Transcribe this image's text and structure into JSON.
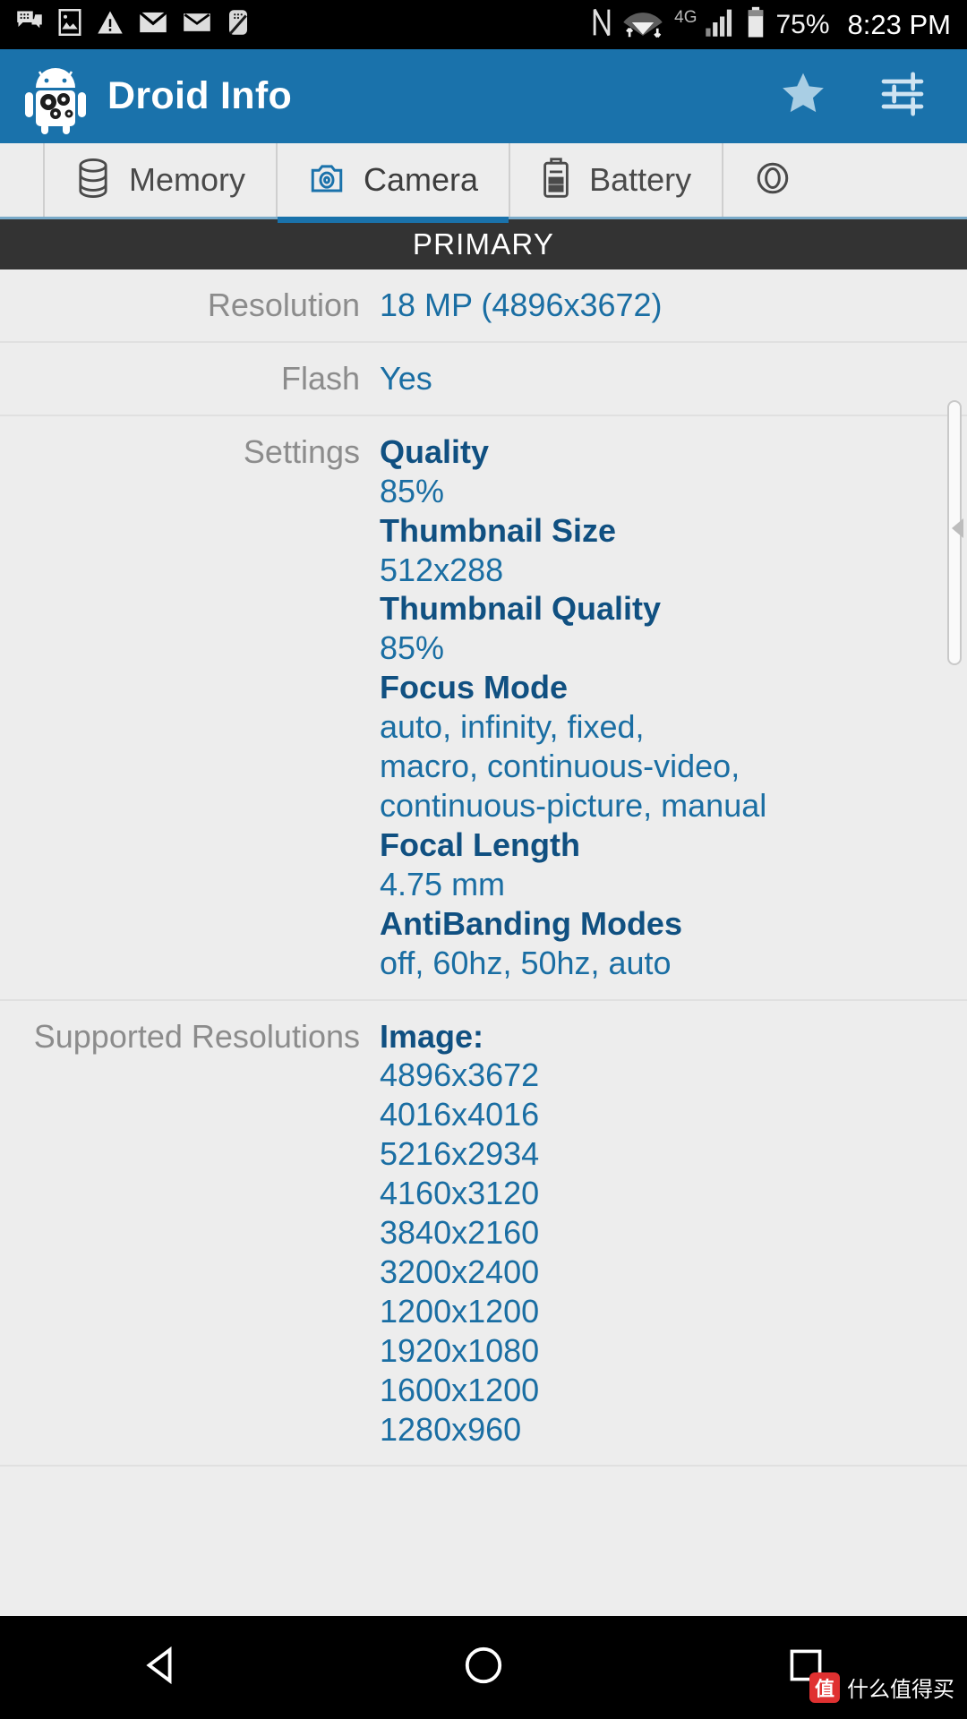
{
  "statusbar": {
    "icons_left": [
      "chat-bubble-icon",
      "image-icon",
      "warning-triangle-icon",
      "mail-filled-icon",
      "mail-outline-icon",
      "note-slash-icon"
    ],
    "icons_right": [
      "nfc-icon",
      "wifi-icon",
      "signal-bars-icon",
      "battery-icon"
    ],
    "network_type": "4G",
    "battery_percent": "75%",
    "time": "8:23 PM"
  },
  "appbar": {
    "logo_icon": "android-droid-gears-icon",
    "title": "Droid Info",
    "star_icon": "star-icon",
    "settings_icon": "sliders-icon"
  },
  "tabs": [
    {
      "label": "Memory",
      "icon": "database-icon",
      "active": false
    },
    {
      "label": "Camera",
      "icon": "camera-icon",
      "active": true
    },
    {
      "label": "Battery",
      "icon": "battery-vertical-icon",
      "active": false
    },
    {
      "label": "",
      "icon": "eye-icon",
      "active": false
    }
  ],
  "section_header": "PRIMARY",
  "rows": [
    {
      "label": "Resolution",
      "lines": [
        {
          "text": "18 MP (4896x3672)",
          "bold": false
        }
      ]
    },
    {
      "label": "Flash",
      "lines": [
        {
          "text": "Yes",
          "bold": false
        }
      ]
    },
    {
      "label": "Settings",
      "lines": [
        {
          "text": "Quality",
          "bold": true
        },
        {
          "text": "85%",
          "bold": false
        },
        {
          "text": "Thumbnail Size",
          "bold": true
        },
        {
          "text": "512x288",
          "bold": false
        },
        {
          "text": "Thumbnail Quality",
          "bold": true
        },
        {
          "text": "85%",
          "bold": false
        },
        {
          "text": "Focus Mode",
          "bold": true
        },
        {
          "text": "auto, infinity, fixed,",
          "bold": false
        },
        {
          "text": "macro, continuous-video,",
          "bold": false
        },
        {
          "text": "continuous-picture, manual",
          "bold": false
        },
        {
          "text": "Focal Length",
          "bold": true
        },
        {
          "text": "4.75 mm",
          "bold": false
        },
        {
          "text": "AntiBanding Modes",
          "bold": true
        },
        {
          "text": "off, 60hz, 50hz, auto",
          "bold": false
        }
      ]
    },
    {
      "label": "Supported Resolutions",
      "lines": [
        {
          "text": "Image:",
          "bold": true
        },
        {
          "text": "4896x3672",
          "bold": false
        },
        {
          "text": "4016x4016",
          "bold": false
        },
        {
          "text": "5216x2934",
          "bold": false
        },
        {
          "text": "4160x3120",
          "bold": false
        },
        {
          "text": "3840x2160",
          "bold": false
        },
        {
          "text": "3200x2400",
          "bold": false
        },
        {
          "text": "1200x1200",
          "bold": false
        },
        {
          "text": "1920x1080",
          "bold": false
        },
        {
          "text": "1600x1200",
          "bold": false
        },
        {
          "text": "1280x960",
          "bold": false
        }
      ]
    }
  ],
  "navbar": {
    "back_icon": "triangle-back-icon",
    "home_icon": "circle-home-icon",
    "recents_icon": "square-recents-icon"
  },
  "watermark": {
    "badge": "值",
    "text": "什么值得买"
  },
  "colors": {
    "appbar": "#1a72ab",
    "accent": "#1a5f8f",
    "value_text": "#1a6ea3",
    "label_text": "#8c8c8c",
    "section_header_bg": "#333333",
    "page_bg": "#ededed"
  }
}
